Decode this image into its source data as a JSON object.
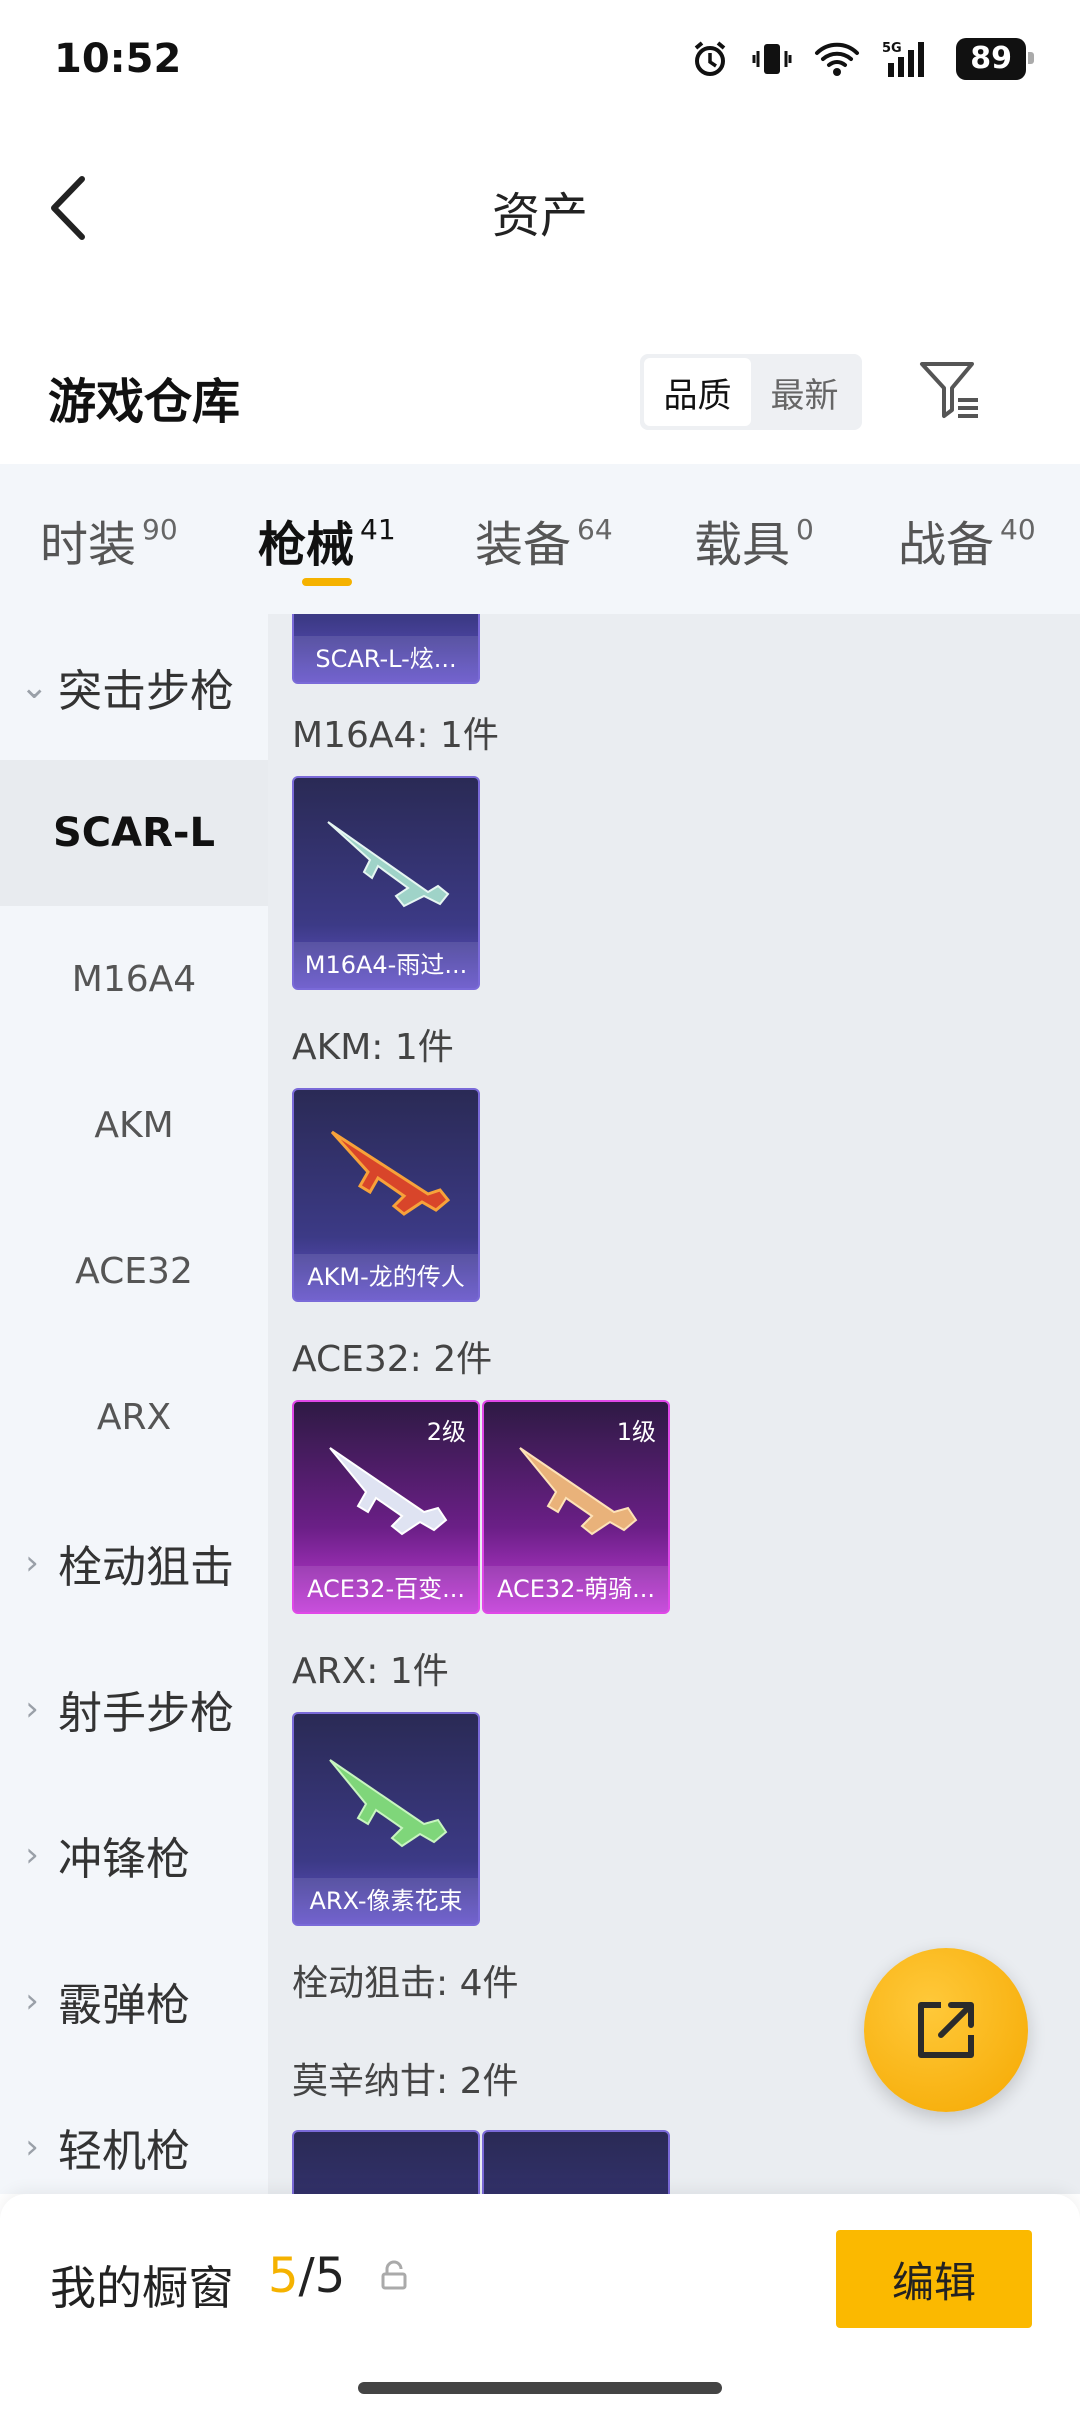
{
  "status_bar": {
    "time": "10:52",
    "battery": "89",
    "network": "5G"
  },
  "header": {
    "title": "资产"
  },
  "section": {
    "title": "游戏仓库",
    "sort_quality": "品质",
    "sort_newest": "最新"
  },
  "tabs": [
    {
      "label": "时装",
      "count": "90"
    },
    {
      "label": "枪械",
      "count": "41"
    },
    {
      "label": "装备",
      "count": "64"
    },
    {
      "label": "载具",
      "count": "0"
    },
    {
      "label": "战备",
      "count": "40"
    }
  ],
  "sidebar": {
    "groups": [
      {
        "label": "突击步枪"
      },
      {
        "label": "栓动狙击"
      },
      {
        "label": "射手步枪"
      },
      {
        "label": "冲锋枪"
      },
      {
        "label": "霰弹枪"
      },
      {
        "label": "轻机枪"
      }
    ],
    "subitems": [
      "SCAR-L",
      "M16A4",
      "AKM",
      "ACE32",
      "ARX"
    ]
  },
  "content": {
    "top_partial_card": "SCAR-L-炫...",
    "groups": [
      {
        "label": "M16A4: 1件",
        "items": [
          {
            "name": "M16A4-雨过..."
          }
        ]
      },
      {
        "label": "AKM: 1件",
        "items": [
          {
            "name": "AKM-龙的传人"
          }
        ]
      },
      {
        "label": "ACE32: 2件",
        "items": [
          {
            "name": "ACE32-百变...",
            "level": "2级"
          },
          {
            "name": "ACE32-萌骑...",
            "level": "1级"
          }
        ]
      },
      {
        "label": "ARX: 1件",
        "items": [
          {
            "name": "ARX-像素花束"
          }
        ]
      },
      {
        "label": "栓动狙击: 4件"
      },
      {
        "label": "莫辛纳甘: 2件"
      }
    ]
  },
  "bottom_bar": {
    "label": "我的橱窗",
    "current": "5",
    "separator": "/",
    "total": "5",
    "edit": "编辑"
  },
  "colors": {
    "accent": "#fbb900",
    "purple_card": "#3c3a86",
    "pink_card": "#c23bd8"
  }
}
